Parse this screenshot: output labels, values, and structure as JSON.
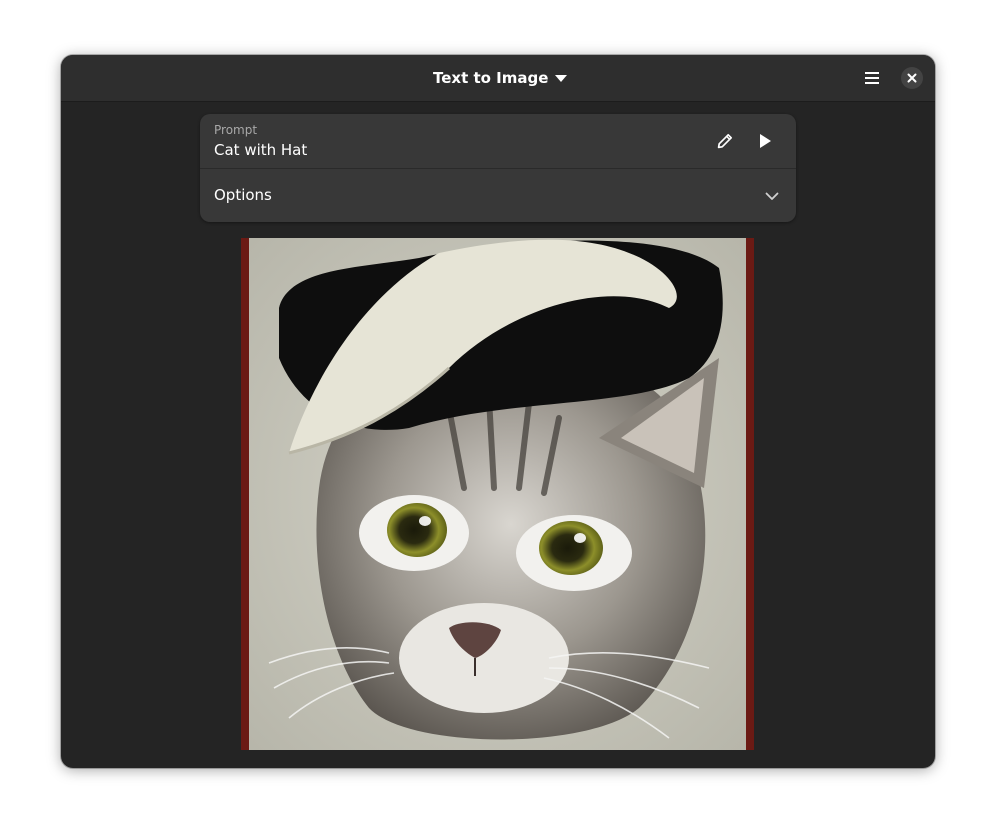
{
  "header": {
    "title": "Text to Image",
    "title_icon": "pan-down-icon",
    "menu_icon": "hamburger-menu-icon",
    "close_icon": "close-icon"
  },
  "prompt": {
    "caption": "Prompt",
    "value": "Cat with Hat",
    "edit_icon": "pencil-icon",
    "run_icon": "play-icon"
  },
  "options": {
    "label": "Options",
    "icon": "chevron-down-icon"
  },
  "image": {
    "subject": "generated-image-cat-with-hat"
  },
  "colors": {
    "window_bg": "#242424",
    "headerbar_bg": "#2e2e2e",
    "card_bg": "#383838",
    "text": "#ffffff",
    "dim_text": "#a8a8a8",
    "close_button_bg": "#434343"
  }
}
